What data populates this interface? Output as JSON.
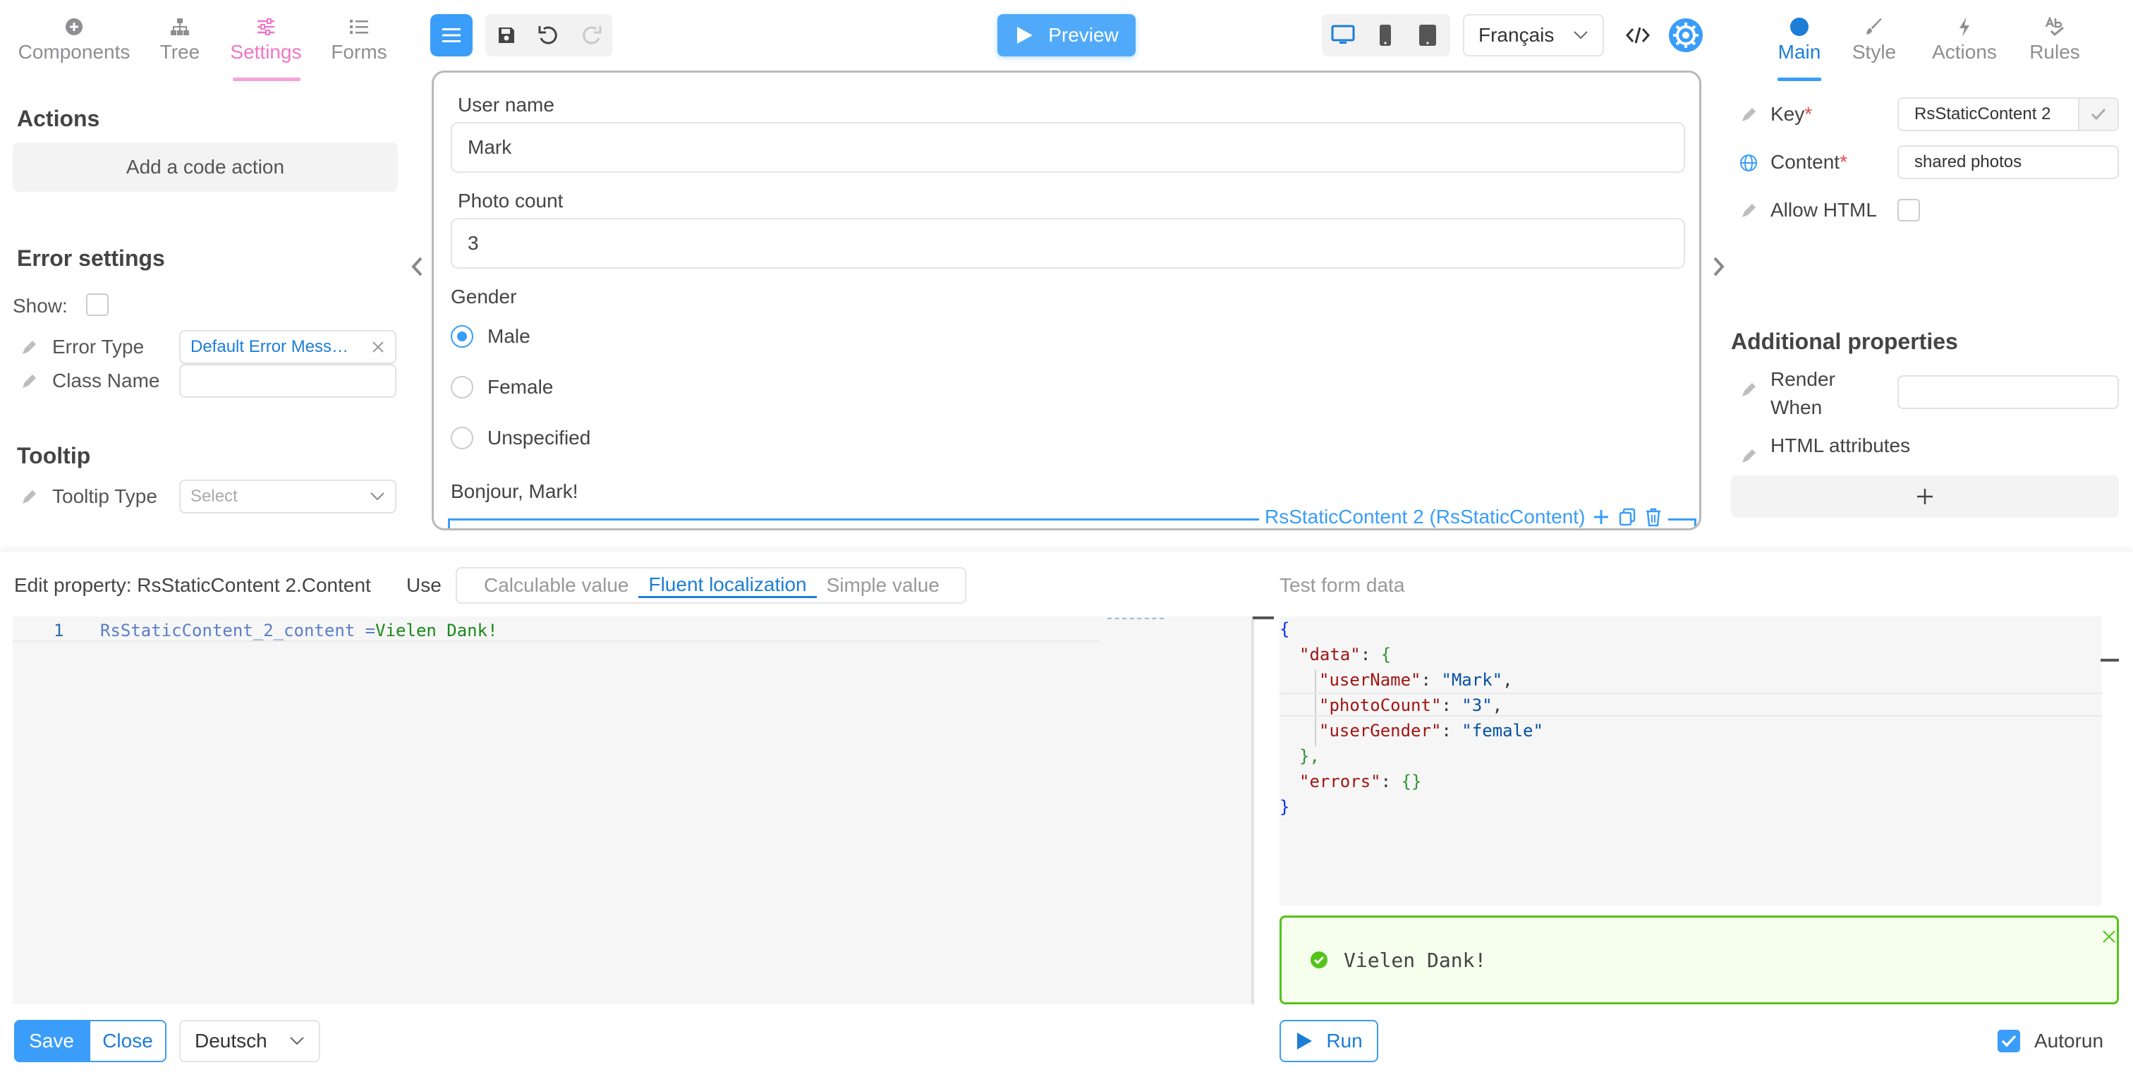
{
  "left_tabs": [
    {
      "label": "Components",
      "icon": "plus-circle-icon"
    },
    {
      "label": "Tree",
      "icon": "sitemap-icon"
    },
    {
      "label": "Settings",
      "icon": "sliders-icon"
    },
    {
      "label": "Forms",
      "icon": "list-icon"
    }
  ],
  "actions": {
    "title": "Actions",
    "add_code_action": "Add a code action"
  },
  "error_settings": {
    "title": "Error settings",
    "show_label": "Show:",
    "error_type_label": "Error Type",
    "error_type_value": "Default Error Mess…",
    "class_name_label": "Class Name"
  },
  "tooltip": {
    "title": "Tooltip",
    "type_label": "Tooltip Type",
    "type_placeholder": "Select"
  },
  "toolbar": {
    "preview_label": "Preview",
    "language": "Français"
  },
  "form": {
    "user_name_label": "User name",
    "user_name_value": "Mark",
    "photo_count_label": "Photo count",
    "photo_count_value": "3",
    "gender_label": "Gender",
    "gender_options": [
      "Male",
      "Female",
      "Unspecified"
    ],
    "greeting": "Bonjour, Mark!",
    "selected_component": "RsStaticContent 2 (RsStaticContent)"
  },
  "right_tabs": [
    {
      "label": "Main",
      "icon": "circle-icon"
    },
    {
      "label": "Style",
      "icon": "brush-icon"
    },
    {
      "label": "Actions",
      "icon": "bolt-icon"
    },
    {
      "label": "Rules",
      "icon": "spellcheck-icon"
    }
  ],
  "props": {
    "key_label": "Key",
    "key_value": "RsStaticContent 2",
    "content_label": "Content",
    "content_value": "shared photos",
    "allow_html_label": "Allow HTML",
    "additional_title": "Additional properties",
    "render_when_label": "Render When",
    "html_attributes_label": "HTML attributes"
  },
  "editor": {
    "title": "Edit property: RsStaticContent 2.Content",
    "use_label": "Use",
    "modes": [
      "Calculable value",
      "Fluent localization",
      "Simple value"
    ],
    "active_mode": "Fluent localization",
    "line_number": "1",
    "code_key": "RsStaticContent_2_content",
    "code_eq": " =",
    "code_value": "Vielen Dank!",
    "save": "Save",
    "close": "Close",
    "language": "Deutsch"
  },
  "test": {
    "title": "Test form data",
    "json_lines": {
      "l1": "{",
      "l2_key": "\"data\"",
      "l3_key": "\"userName\"",
      "l3_val": "\"Mark\"",
      "l4_key": "\"photoCount\"",
      "l4_val": "\"3\"",
      "l5_key": "\"userGender\"",
      "l5_val": "\"female\"",
      "l6": "},",
      "l7_key": "\"errors\"",
      "l7_val": "{}",
      "l8": "}"
    },
    "result": "Vielen Dank!",
    "run": "Run",
    "autorun": "Autorun"
  },
  "colors": {
    "accent": "#3a9df9",
    "settings_pink": "#f076c6",
    "success": "#52c41a"
  }
}
